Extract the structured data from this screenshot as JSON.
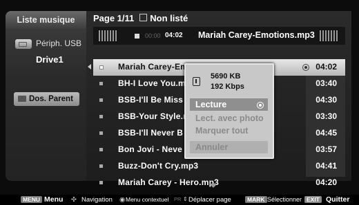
{
  "sidebar": {
    "tab_label": "Liste musique",
    "device_label": "Périph. USB",
    "drive_label": "Drive1",
    "parent_button_label": "Dos. Parent"
  },
  "header": {
    "page_text": "Page 1/11",
    "filter_text": "Non listé"
  },
  "now_playing": {
    "elapsed_dim": "00:00",
    "elapsed": "04:02",
    "title": "Mariah Carey-Emotions.mp3"
  },
  "tracks": [
    {
      "name": "Mariah Carey-Emotions.mp3",
      "duration": "04:02"
    },
    {
      "name": "BH-I Love You.mp3",
      "duration": "03:40"
    },
    {
      "name": "BSB-I'll Be Missing You.mp3",
      "duration": "04:30"
    },
    {
      "name": "BSB-Your Style.mp3",
      "duration": "03:30"
    },
    {
      "name": "BSB-I'll Never Break.mp3",
      "duration": "04:45"
    },
    {
      "name": "Bon Jovi - Never Say Goodbye.mp3",
      "duration": "03:57"
    },
    {
      "name": "Buzz-Don't Cry.mp3",
      "duration": "04:41"
    },
    {
      "name": "Mariah Carey - Hero.mp3",
      "duration": "04:20"
    }
  ],
  "track_display": [
    "Mariah Carey-Emotions.mp3",
    "BH-I Love You.m",
    "BSB-I'll Be Miss",
    "BSB-Your Style.n",
    "BSB-I'll Never B",
    "Bon Jovi - Neve",
    "Buzz-Don't Cry.mp3",
    "Mariah Carey - Hero.mp3"
  ],
  "popup": {
    "file_size": "5690 KB",
    "bitrate": "192 Kbps",
    "items": [
      "Lecture",
      "Lect. avec photo",
      "Marquer tout",
      "Annuler"
    ]
  },
  "footer": {
    "menu_key": "MENU",
    "menu_label": "Menu",
    "nav_label": "Navigation",
    "context_label": "Menu contextuel",
    "page_key": "PR",
    "page_label": "Déplacer page",
    "mark_key": "MARK",
    "mark_label": "Sélectionner",
    "exit_key": "EXIT",
    "exit_label": "Quitter"
  },
  "colors": {
    "selected_row": "#d8d8d8",
    "popup_bg": "#c8c8c8",
    "background": "#0c0c0c"
  }
}
